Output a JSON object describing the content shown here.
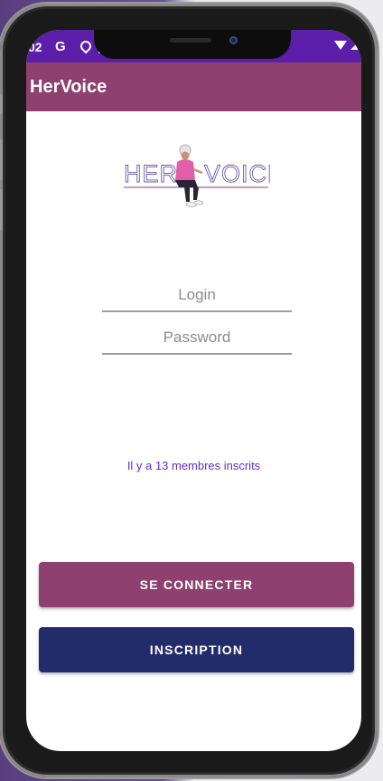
{
  "status_bar": {
    "time": "02",
    "g_label": "G"
  },
  "app_bar": {
    "title": "HerVoice"
  },
  "logo": {
    "text_left": "HER",
    "text_right": "VOICE"
  },
  "form": {
    "login_placeholder": "Login",
    "password_placeholder": "Password"
  },
  "members_text": "Il y a 13 membres inscrits",
  "buttons": {
    "connect_label": "SE CONNECTER",
    "inscription_label": "INSCRIPTION"
  },
  "colors": {
    "status_bar": "#5b1ea8",
    "app_bar": "#8e406e",
    "connect_button": "#8e406e",
    "inscription_button": "#232c6b",
    "members_text": "#6a2bd0"
  }
}
